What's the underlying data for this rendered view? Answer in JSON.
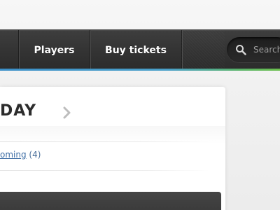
{
  "nav": {
    "items": [
      {
        "label": "Players"
      },
      {
        "label": "Buy tickets"
      }
    ]
  },
  "search": {
    "placeholder": "Search"
  },
  "card": {
    "title": "DAY",
    "filter": {
      "link_label": "oming",
      "count_label": "(4)"
    }
  },
  "colors": {
    "nav_bg": "#353535",
    "accent_blue": "#3b8fc8",
    "accent_green": "#6bbf4d",
    "link": "#3f6fa6"
  },
  "icons": {
    "search": "search-icon",
    "chevron": "chevron-right-icon"
  }
}
